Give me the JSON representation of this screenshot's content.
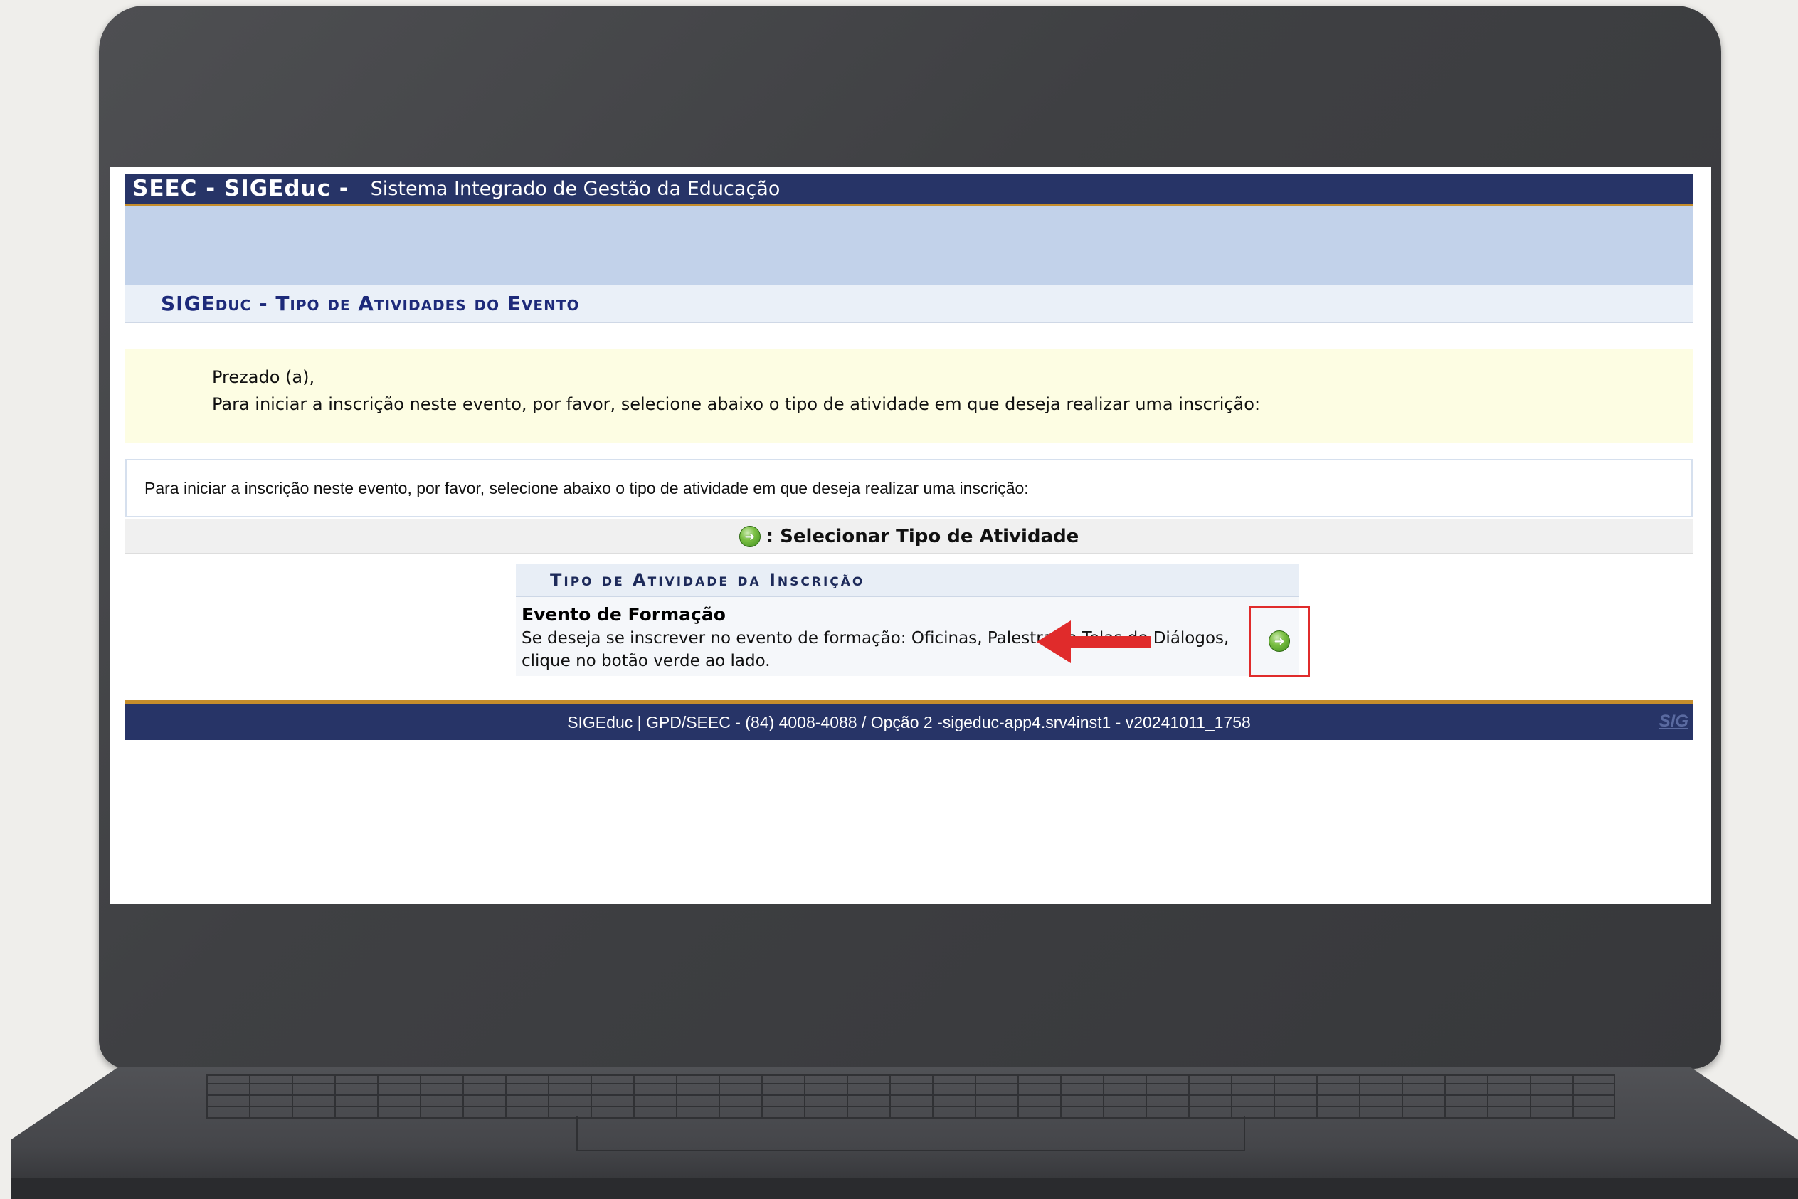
{
  "header": {
    "brand": "SEEC - SIGEduc -",
    "system_name": "Sistema Integrado de Gestão da Educação"
  },
  "page": {
    "title": "SIGEduc - Tipo de Atividades do Evento"
  },
  "notice": {
    "greeting": "Prezado (a),",
    "message": "Para iniciar a inscrição neste evento, por favor, selecione abaixo o tipo de atividade em que deseja realizar uma inscrição:"
  },
  "instruction": {
    "text": "Para iniciar a inscrição neste evento, por favor, selecione abaixo o tipo de atividade em que deseja realizar uma inscrição:"
  },
  "action_bar": {
    "icon": "go-arrow-icon",
    "label": ": Selecionar Tipo de Atividade"
  },
  "activity_table": {
    "header": "Tipo de Atividade da Inscrição",
    "rows": [
      {
        "name": "Evento de Formação",
        "description": "Se deseja se inscrever no evento de formação: Oficinas, Palestras e Telas de Diálogos, clique no botão verde ao lado."
      }
    ]
  },
  "footer": {
    "text": "SIGEduc | GPD/SEEC - (84) 4008-4088 / Opção 2 -sigeduc-app4.srv4inst1 - v20241011_1758",
    "logo": "SIG"
  },
  "colors": {
    "header_bg": "#273467",
    "accent_stripe": "#c58d2b",
    "highlight_box": "#e02b2b",
    "go_button": "#7bc043"
  }
}
